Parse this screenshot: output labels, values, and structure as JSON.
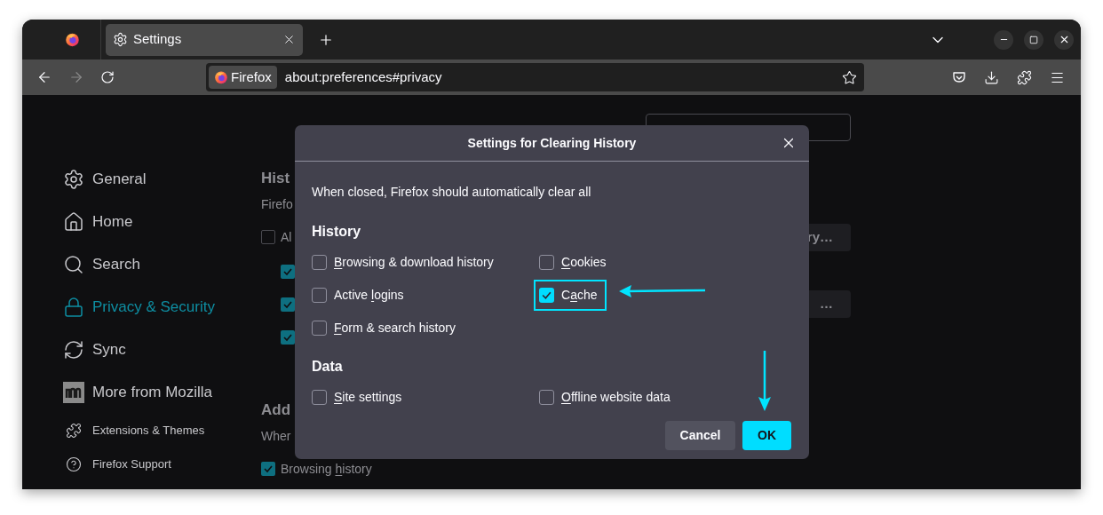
{
  "tabs": [
    {
      "label": "Settings",
      "selected": true
    }
  ],
  "toolbar": {
    "back_disabled": false,
    "forward_disabled": true,
    "identity": "Firefox",
    "url": "about:preferences#privacy"
  },
  "sidebar": {
    "items": [
      {
        "label": "General",
        "kind": "category",
        "selected": false
      },
      {
        "label": "Home",
        "kind": "category",
        "selected": false
      },
      {
        "label": "Search",
        "kind": "category",
        "selected": false
      },
      {
        "label": "Privacy & Security",
        "kind": "category",
        "selected": true
      },
      {
        "label": "Sync",
        "kind": "category",
        "selected": false
      },
      {
        "label": "More from Mozilla",
        "kind": "category",
        "selected": false
      },
      {
        "label": "Extensions & Themes",
        "kind": "link",
        "selected": false
      },
      {
        "label": "Firefox Support",
        "kind": "link",
        "selected": false
      }
    ]
  },
  "page": {
    "rows": [
      {
        "kind": "heading",
        "text": "Hist"
      },
      {
        "kind": "text",
        "text": "Firefo"
      },
      {
        "kind": "checkbox",
        "text": "Al",
        "checked": false,
        "button": "ry…"
      },
      {
        "kind": "subcheckbox",
        "checked": true
      },
      {
        "kind": "subcheckbox",
        "checked": true,
        "button": "…"
      },
      {
        "kind": "subcheckbox",
        "checked": true
      },
      {
        "kind": "heading",
        "text": "Add"
      },
      {
        "kind": "text",
        "text": "Wher"
      },
      {
        "kind": "checkbox",
        "before": "Browsing ",
        "key": "h",
        "after": "istory",
        "checked": true
      }
    ]
  },
  "dialog": {
    "title": "Settings for Clearing History",
    "intro": "When closed, Firefox should automatically clear all",
    "sections": [
      {
        "heading": "History",
        "items": [
          {
            "key": "B",
            "after": "rowsing & download history",
            "checked": false,
            "highlighted": false
          },
          {
            "key": "C",
            "after": "ookies",
            "checked": false,
            "highlighted": false
          },
          {
            "before": "Active ",
            "key": "l",
            "after": "ogins",
            "checked": false,
            "highlighted": false
          },
          {
            "before": "C",
            "key": "a",
            "after": "che",
            "checked": true,
            "highlighted": true
          },
          {
            "key": "F",
            "after": "orm & search history",
            "checked": false,
            "highlighted": false
          }
        ]
      },
      {
        "heading": "Data",
        "items": [
          {
            "key": "S",
            "after": "ite settings",
            "checked": false,
            "highlighted": false
          },
          {
            "key": "O",
            "after": "ffline website data",
            "checked": false,
            "highlighted": false
          }
        ]
      }
    ],
    "buttons": [
      {
        "label": "Cancel",
        "kind": "secondary"
      },
      {
        "label": "OK",
        "kind": "primary"
      }
    ]
  }
}
